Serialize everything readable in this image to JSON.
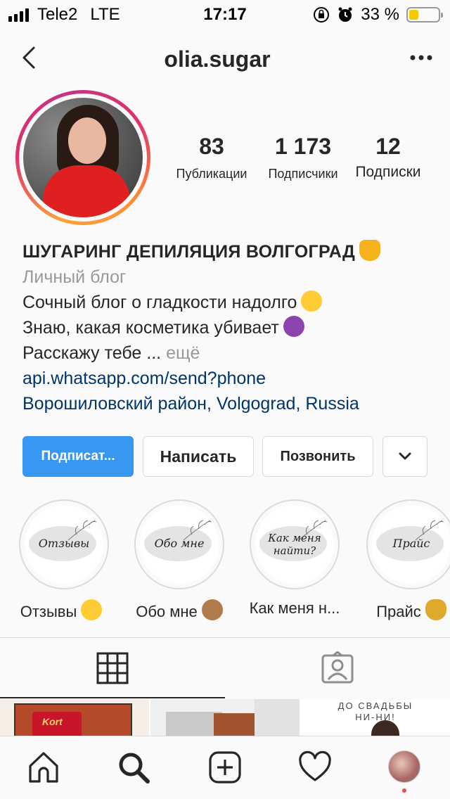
{
  "status_bar": {
    "carrier": "Tele2",
    "network": "LTE",
    "time": "17:17",
    "battery_percent": "33 %",
    "battery_level": 0.33,
    "icons": [
      "signal-icon",
      "orientation-lock-icon",
      "alarm-icon",
      "battery-icon"
    ]
  },
  "header": {
    "username": "olia.sugar",
    "back_icon": "chevron-left-icon",
    "more_icon": "more-dots-icon"
  },
  "stats": {
    "posts": {
      "value": "83",
      "label": "Публикации"
    },
    "followers": {
      "value": "1 173",
      "label": "Подписчики"
    },
    "following": {
      "value": "12",
      "label": "Подписки"
    }
  },
  "bio": {
    "name": "ШУГАРИНГ ДЕПИЛЯЦИЯ ВОЛГОГРАД",
    "category": "Личный блог",
    "line1": "Сочный блог о гладкости надолго",
    "line2": "Знаю, какая косметика убивает",
    "line3": "Расскажу тебе ...",
    "more": "ещё",
    "link": "api.whatsapp.com/send?phone",
    "location": "Ворошиловский район, Volgograd, Russia"
  },
  "buttons": {
    "follow": "Подписат...",
    "message": "Написать",
    "call": "Позвонить",
    "dropdown_icon": "chevron-down-icon"
  },
  "highlights": [
    {
      "label": "Отзывы",
      "cover_text": "Отзывы"
    },
    {
      "label": "Обо мне",
      "cover_text": "Обо мне"
    },
    {
      "label": "Как меня н...",
      "cover_text_1": "Как меня",
      "cover_text_2": "найти?"
    },
    {
      "label": "Прайс",
      "cover_text": "Прайс"
    }
  ],
  "tabs": {
    "grid_icon": "grid-icon",
    "tagged_icon": "tagged-person-icon",
    "active": "grid"
  },
  "feed": {
    "thumb1_text": "Kort",
    "thumb3_text_1": "ДО СВАДЬБЫ",
    "thumb3_text_2": "НИ-НИ!"
  },
  "bottom_nav": [
    "home-icon",
    "search-icon",
    "add-post-icon",
    "heart-icon",
    "profile-avatar"
  ],
  "colors": {
    "accent": "#3897f0",
    "link": "#003569",
    "muted": "#999999",
    "notification_dot": "#ed4956"
  }
}
